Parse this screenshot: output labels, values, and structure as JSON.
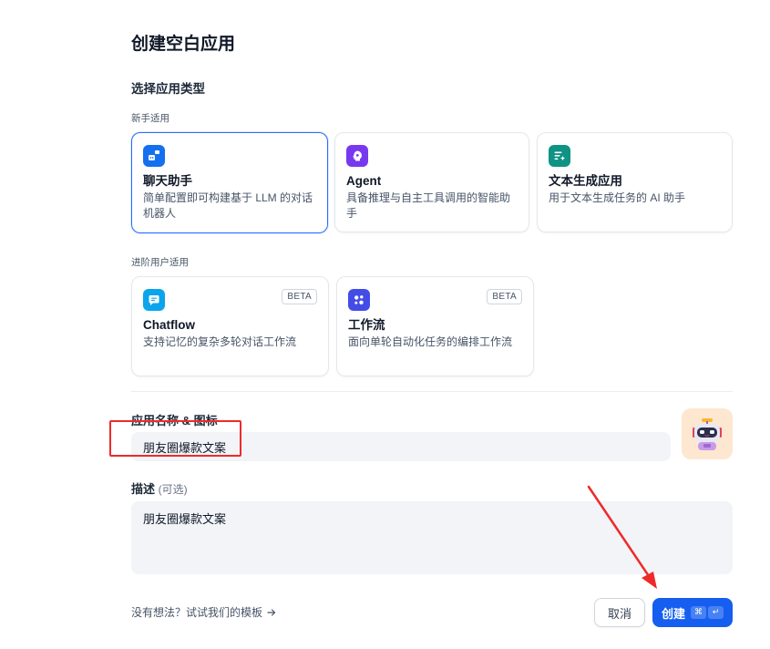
{
  "title": "创建空白应用",
  "section_title": "选择应用类型",
  "groups": {
    "beginner": {
      "label": "新手适用",
      "cards": [
        {
          "title": "聊天助手",
          "desc": "简单配置即可构建基于 LLM 的对话机器人",
          "icon": "chat-bot-icon",
          "color": "#1570ef",
          "selected": true
        },
        {
          "title": "Agent",
          "desc": "具备推理与自主工具调用的智能助手",
          "icon": "agent-icon",
          "color": "#7839ee",
          "selected": false
        },
        {
          "title": "文本生成应用",
          "desc": "用于文本生成任务的 AI 助手",
          "icon": "text-generator-icon",
          "color": "#0e9384",
          "selected": false
        }
      ]
    },
    "advanced": {
      "label": "进阶用户适用",
      "cards": [
        {
          "title": "Chatflow",
          "desc": "支持记忆的复杂多轮对话工作流",
          "badge": "BETA",
          "icon": "chatflow-icon",
          "color": "#0ba5ec"
        },
        {
          "title": "工作流",
          "desc": "面向单轮自动化任务的编排工作流",
          "badge": "BETA",
          "icon": "workflow-icon",
          "color": "#444ce7"
        }
      ]
    }
  },
  "name_field": {
    "label": "应用名称 & 图标",
    "value": "朋友圈爆款文案",
    "avatar": "robot-avatar-icon"
  },
  "desc_field": {
    "label": "描述",
    "optional": "(可选)",
    "value": "朋友圈爆款文案"
  },
  "footer": {
    "template_link": "没有想法？试试我们的模板",
    "cancel": "取消",
    "create": "创建",
    "shortcut": [
      "⌘",
      "↵"
    ]
  },
  "colors": {
    "primary": "#155eef",
    "selected_border": "#296dff",
    "annotation": "#ee2a2a"
  }
}
